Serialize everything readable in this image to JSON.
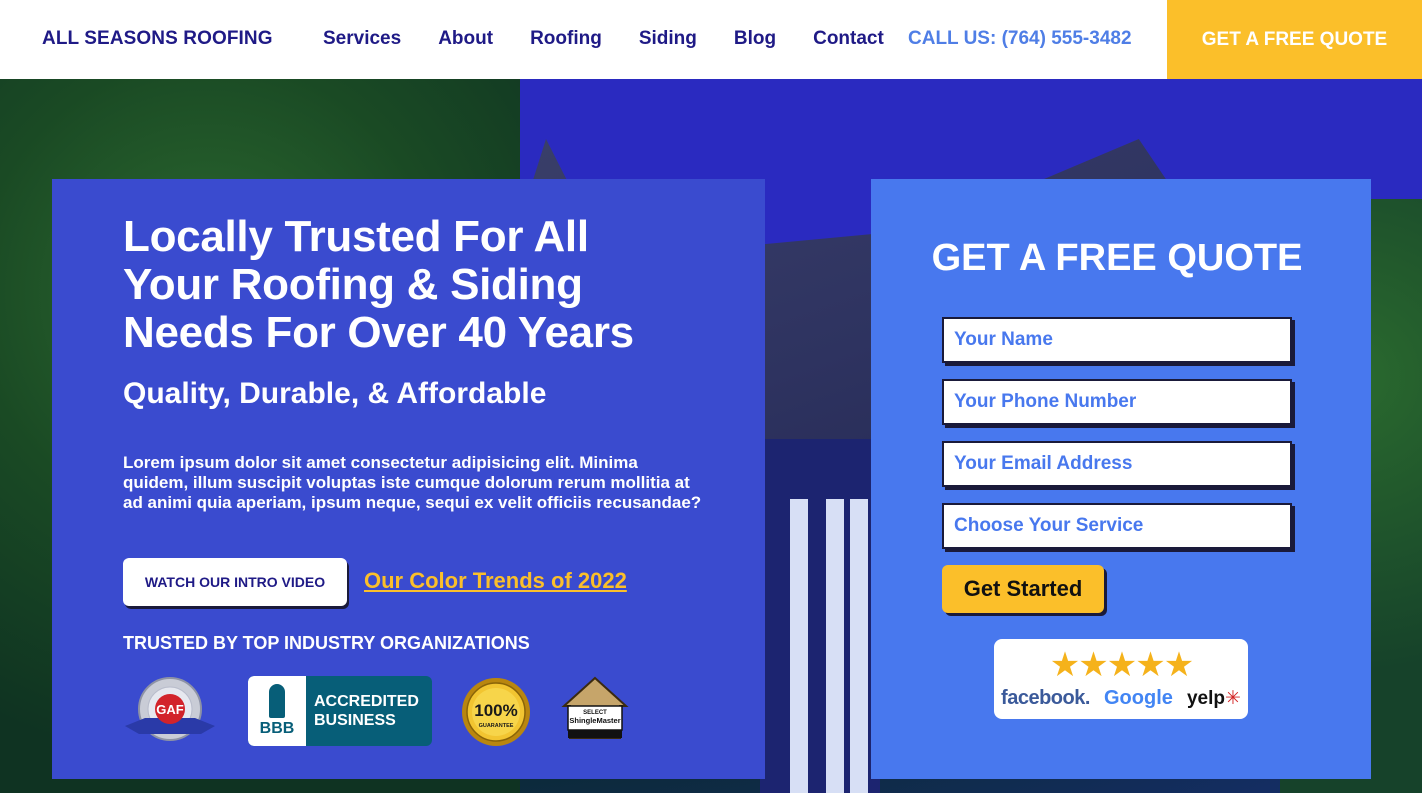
{
  "header": {
    "logo": "ALL SEASONS ROOFING",
    "nav": [
      "Services",
      "About",
      "Roofing",
      "Siding",
      "Blog",
      "Contact"
    ],
    "call": "CALL US: (764) 555-3482",
    "cta": "GET A FREE QUOTE"
  },
  "hero": {
    "headline": "Locally Trusted For All Your Roofing & Siding Needs For Over 40 Years",
    "subhead": "Quality, Durable, & Affordable",
    "paragraph": "Lorem ipsum dolor sit amet consectetur adipisicing elit. Minima quidem, illum suscipit voluptas iste cumque dolorum rerum mollitia at ad animi quia aperiam, ipsum neque, sequi ex velit officiis recusandae?",
    "video_button": "WATCH OUR INTRO VIDEO",
    "trend_link": "Our Color Trends of 2022",
    "trusted_title": "TRUSTED BY TOP INDUSTRY ORGANIZATIONS",
    "badges": {
      "gaf": "GAF",
      "bbb_logo": "BBB",
      "bbb_line1": "ACCREDITED",
      "bbb_line2": "BUSINESS",
      "guarantee": "100%",
      "guarantee_sub": "GUARANTEE",
      "shinglemaster": "ShingleMaster",
      "shinglemaster_top": "SELECT"
    }
  },
  "form": {
    "title": "GET A FREE QUOTE",
    "name_placeholder": "Your Name",
    "phone_placeholder": "Your Phone Number",
    "email_placeholder": "Your Email Address",
    "service_placeholder": "Choose Your Service",
    "submit": "Get Started"
  },
  "reviews": {
    "stars": "★★★★★",
    "facebook": "facebook.",
    "google": "Google",
    "yelp": "yelp"
  },
  "colors": {
    "navy": "#1f1a86",
    "accent_yellow": "#fbbf2a",
    "left_panel": "#3a4bcf",
    "right_panel": "#4878ee",
    "call_blue": "#4f7ee6"
  }
}
